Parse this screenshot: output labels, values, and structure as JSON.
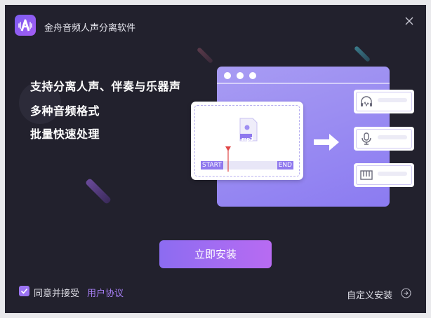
{
  "window": {
    "title": "金舟音频人声分离软件"
  },
  "features": [
    "支持分离人声、伴奏与乐器声",
    "多种音频格式",
    "批量快速处理"
  ],
  "illustration": {
    "file_ext": "mp3",
    "range_start": "START",
    "range_end": "END"
  },
  "buttons": {
    "install": "立即安装",
    "custom_install": "自定义安装"
  },
  "agreement": {
    "checked": true,
    "label": "同意并接受",
    "link": "用户协议"
  },
  "colors": {
    "background": "#22212d",
    "accent": "#9b74f2",
    "link": "#a77ff5"
  }
}
